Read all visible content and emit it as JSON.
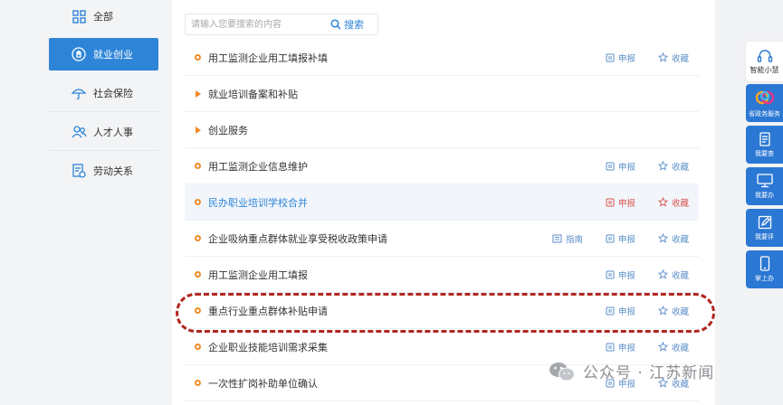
{
  "sidebar": {
    "items": [
      {
        "label": "全部",
        "icon": "grid-icon",
        "active": false
      },
      {
        "label": "就业创业",
        "icon": "rocket-icon",
        "active": true
      },
      {
        "label": "社会保险",
        "icon": "umbrella-icon",
        "active": false
      },
      {
        "label": "人才人事",
        "icon": "people-icon",
        "active": false
      },
      {
        "label": "劳动关系",
        "icon": "contract-icon",
        "active": false
      }
    ]
  },
  "search": {
    "placeholder": "请输入您要搜索的内容",
    "button_label": "搜索"
  },
  "list": {
    "items": [
      {
        "title": "用工监测企业用工填报补填",
        "marker": "circle",
        "apply": "申报",
        "fav": "收藏"
      },
      {
        "title": "就业培训备案和补贴",
        "marker": "triangle"
      },
      {
        "title": "创业服务",
        "marker": "triangle"
      },
      {
        "title": "用工监测企业信息维护",
        "marker": "circle",
        "apply": "申报",
        "fav": "收藏"
      },
      {
        "title": "民办职业培训学校合并",
        "marker": "circle",
        "apply": "申报",
        "fav": "收藏",
        "highlighted": true
      },
      {
        "title": "企业吸纳重点群体就业享受税收政策申请",
        "marker": "circle",
        "guide": "指南",
        "apply": "申报",
        "fav": "收藏"
      },
      {
        "title": "用工监测企业用工填报",
        "marker": "circle",
        "apply": "申报",
        "fav": "收藏"
      },
      {
        "title": "重点行业重点群体补贴申请",
        "marker": "circle",
        "apply": "申报",
        "fav": "收藏"
      },
      {
        "title": "企业职业技能培训需求采集",
        "marker": "circle",
        "apply": "申报",
        "fav": "收藏"
      },
      {
        "title": "一次性扩岗补助单位确认",
        "marker": "circle",
        "apply": "申报",
        "fav": "收藏"
      }
    ]
  },
  "dock": {
    "assistant_label": "智能小慧",
    "buttons": [
      {
        "label": "省政务服务",
        "icon": "service-logo-icon"
      },
      {
        "label": "我要查",
        "icon": "book-icon"
      },
      {
        "label": "我要办",
        "icon": "monitor-icon"
      },
      {
        "label": "我要评",
        "icon": "edit-icon"
      },
      {
        "label": "掌上办",
        "icon": "phone-icon"
      }
    ]
  },
  "watermark": {
    "text": "公众号 · 江苏新闻"
  },
  "colors": {
    "accent": "#2e85d8",
    "marker": "#f08a24",
    "highlight_border": "#b0271f",
    "dock": "#2b78d4"
  }
}
